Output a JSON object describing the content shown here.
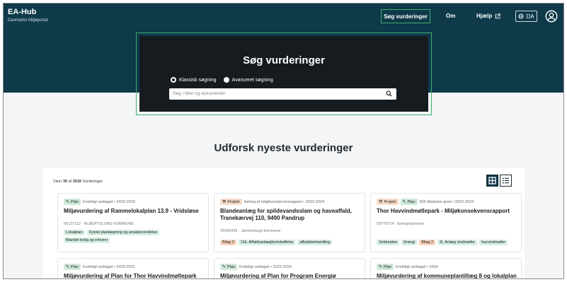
{
  "header": {
    "brand_title": "EA-Hub",
    "brand_subtitle": "Danmarks Miljøportal",
    "nav": {
      "search": "Søg vurderinger",
      "om": "Om",
      "help": "Hjælp"
    },
    "language": "DA"
  },
  "hero": {
    "title": "Søg vurderinger",
    "radio_classic": "Klassisk søgning",
    "radio_advanced": "Avanceret søgning",
    "search_placeholder": "Søg i titler og dokumenter"
  },
  "explore": {
    "title": "Udforsk nyeste vurderinger"
  },
  "results": {
    "count_prefix": "Viser",
    "shown": "30",
    "count_of": "af",
    "total": "2516",
    "count_suffix": "Vurderinger"
  },
  "cards": [
    {
      "tag1": "Plan",
      "tag1_type": "plan",
      "status": "Endeligt vedtaget • 2020-2023",
      "title": "Miljøvurdering af Rammelokalplan 13.9 - Vridsløse",
      "meta": "66137112 · ALBERTSLUND KOMMUNE",
      "chips": [
        {
          "label": "Lokalplan",
          "color": "green"
        },
        {
          "label": "Fysisk planlægning og arealanvendelse",
          "color": "green"
        },
        {
          "label": "Blandet bolig og erhverv",
          "color": "green"
        }
      ]
    },
    {
      "tag1": "Projekt",
      "tag1_type": "projekt",
      "status": "Høring af miljøkonsekvensrapport • 2023-2024",
      "title": "Blandeanlæg for spildevandsslam og haveaffald, Tranekærvej 110, 9490 Pandrup",
      "meta": "29189439 · Jammerbugt kommune",
      "chips": [
        {
          "label": "Bilag 2",
          "color": "orange"
        },
        {
          "label": "11b. Affaldsanlægbortskaffelse",
          "color": "green"
        },
        {
          "label": "affaldsbehandling",
          "color": "green"
        }
      ]
    },
    {
      "tag1": "Projekt",
      "tag1_type": "projekt",
      "tag2": "Plan",
      "status": "§25 tilladelse givet • 2022-2024",
      "title": "Thor Havvindmøllepark - Miljøkonsekvensrapport",
      "meta": "59778714 · Energistyrelsen",
      "chips": [
        {
          "label": "Sektorplan",
          "color": "green"
        },
        {
          "label": "Energi",
          "color": "green"
        },
        {
          "label": "Bilag 2",
          "color": "orange"
        },
        {
          "label": "3i. Anlæg vindmøller",
          "color": "green"
        },
        {
          "label": "havvindmøller",
          "color": "green"
        }
      ]
    },
    {
      "tag1": "Plan",
      "tag1_type": "plan",
      "status": "Endeligt vedtaget • 2020-2021",
      "title": "Miljøvurdering af Plan for Thor Havvindmøllepark"
    },
    {
      "tag1": "Plan",
      "tag1_type": "plan",
      "status": "Endeligt vedtaget • 2022-2024",
      "title": "Miljøvurdering af Plan for Program Energiø Bornholm"
    },
    {
      "tag1": "Plan",
      "tag1_type": "plan",
      "status": "Endeligt vedtaget • 2024",
      "title": "Miljøvurdering af kommuneplantillæg 8 og lokalplan"
    }
  ],
  "colors": {
    "header_bg": "#0e3a4a",
    "accent_green": "#3fae6a",
    "hero_box": "#151b1f"
  }
}
